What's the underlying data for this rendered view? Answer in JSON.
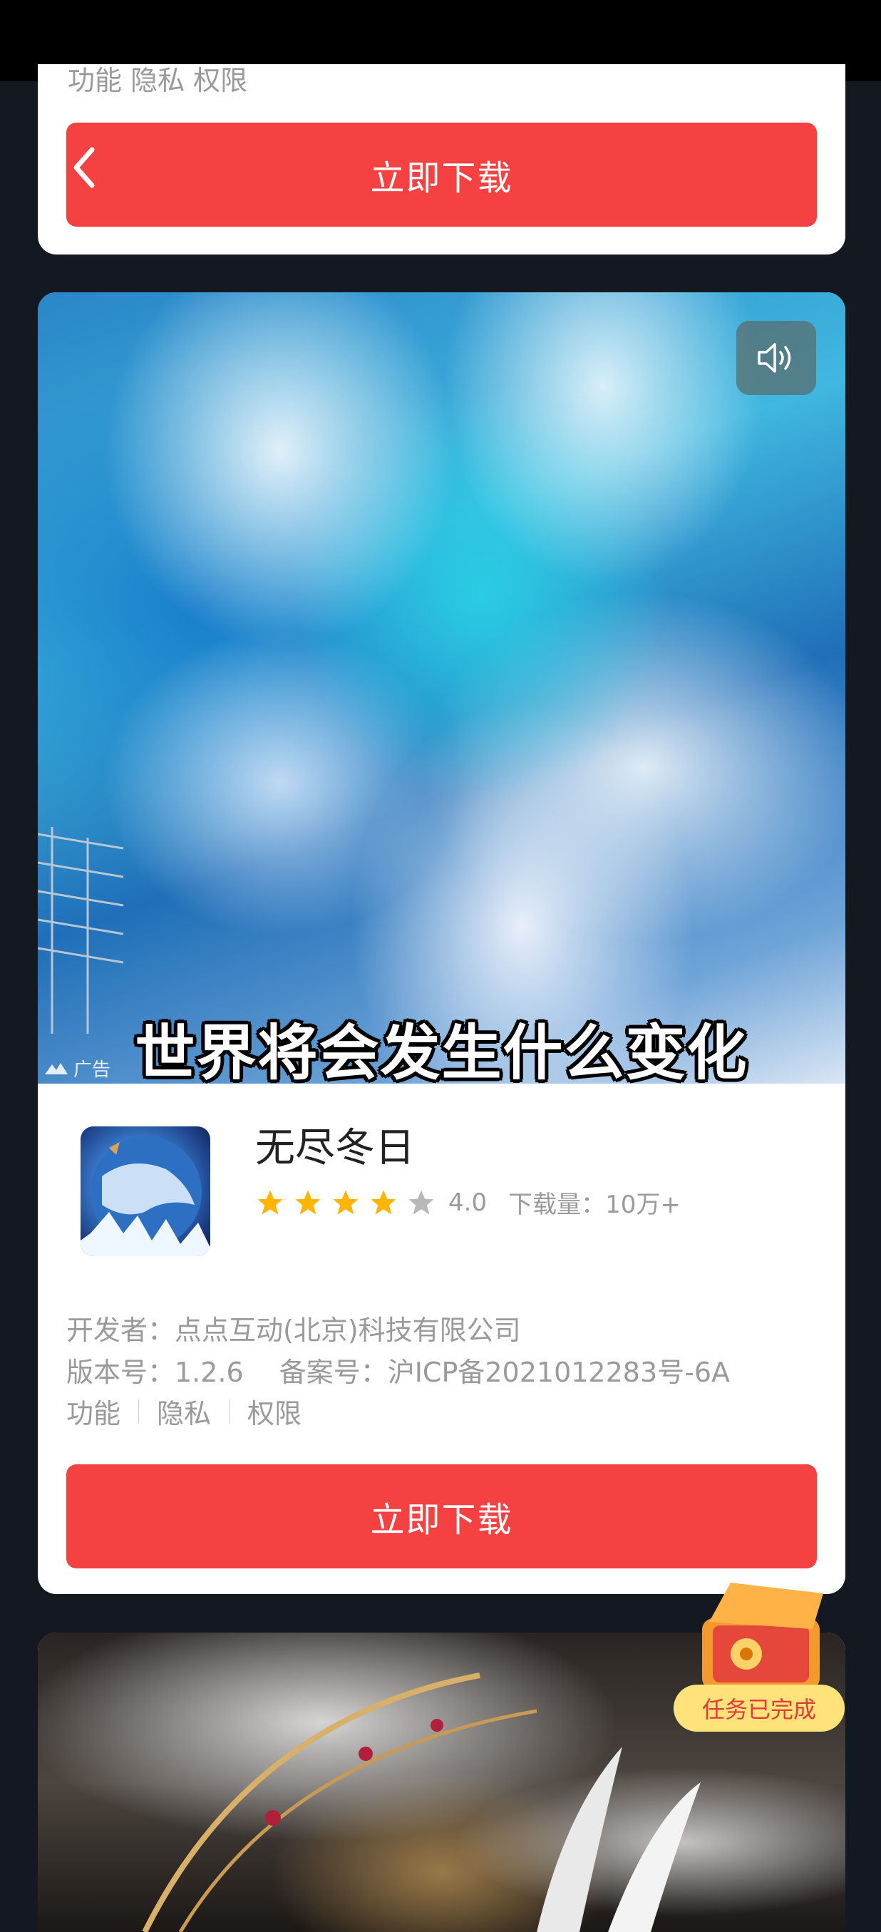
{
  "top_card": {
    "clipped_links": "功能 隐私 权限",
    "download_label": "立即下载"
  },
  "ad_card": {
    "subtitle": "世界将会发生什么变化",
    "ad_label": "广告",
    "app_name": "无尽冬日",
    "rating": "4.0",
    "stars_filled": 4,
    "stars_total": 5,
    "downloads": "下载量：10万+",
    "developer": "开发者：点点互动(北京)科技有限公司",
    "version": "版本号：1.2.6",
    "filing": "备案号：沪ICP备2021012283号-6A",
    "links": [
      "功能",
      "隐私",
      "权限"
    ],
    "download_label": "立即下载",
    "colors": {
      "button": "#f54141",
      "star": "#ffb400"
    }
  },
  "reward_badge": {
    "label": "任务已完成"
  }
}
